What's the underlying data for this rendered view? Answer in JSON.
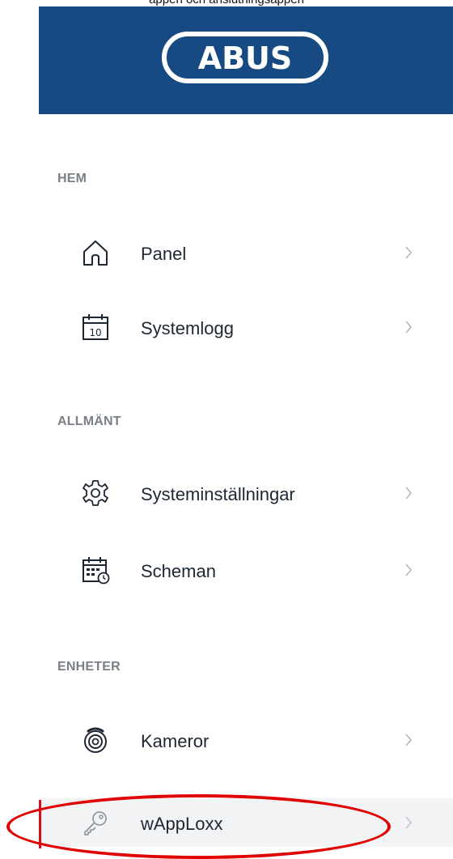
{
  "top_clip_text": "appen och anslutningsappen",
  "brand": {
    "logo_text": "ABUS",
    "header_color": "#174a82"
  },
  "sections": [
    {
      "title": "HEM",
      "items": [
        {
          "label": "Panel",
          "icon": "home-icon"
        },
        {
          "label": "Systemlogg",
          "icon": "calendar-10-icon",
          "icon_text": "10"
        }
      ]
    },
    {
      "title": "ALLMÄNT",
      "items": [
        {
          "label": "Systeminställningar",
          "icon": "gear-icon"
        },
        {
          "label": "Scheman",
          "icon": "calendar-clock-icon"
        }
      ]
    },
    {
      "title": "ENHETER",
      "items": [
        {
          "label": "Kameror",
          "icon": "camera-icon"
        },
        {
          "label": "wAppLoxx",
          "icon": "key-icon",
          "active": true
        }
      ]
    }
  ],
  "colors": {
    "active_marker": "#d40f1e",
    "highlight_ellipse": "#e00000",
    "section_title": "#7a8088"
  }
}
